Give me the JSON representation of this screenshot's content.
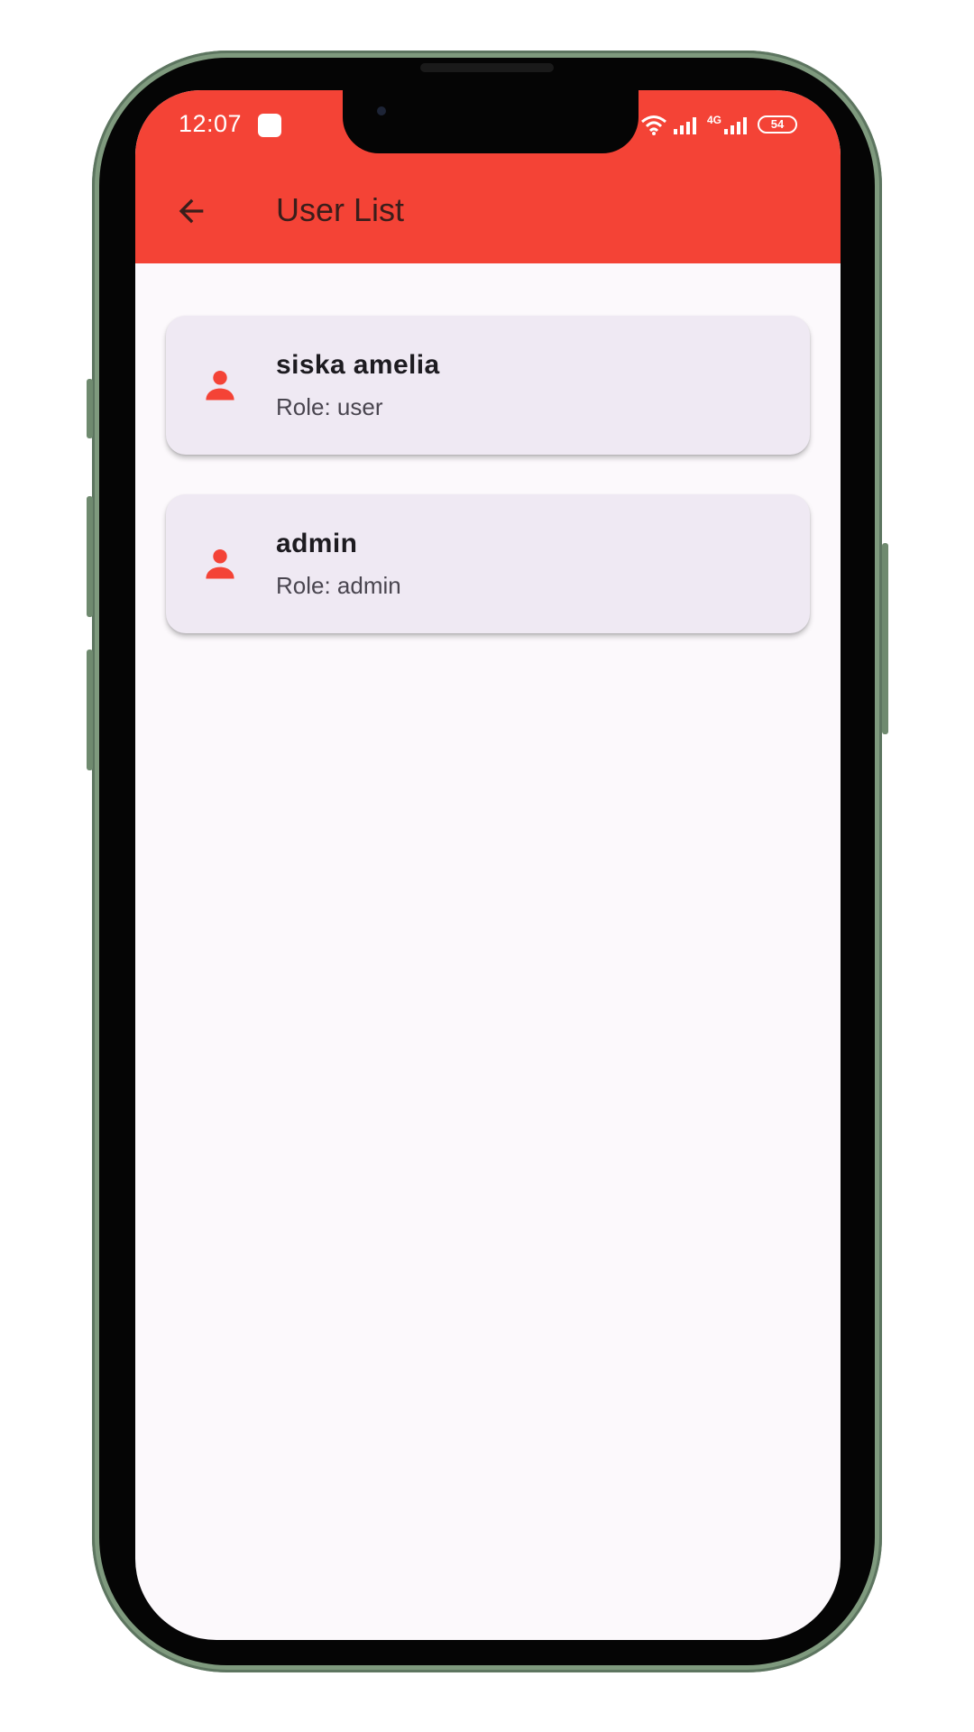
{
  "status_bar": {
    "time": "12:07",
    "battery_level": "54",
    "network_label": "4G"
  },
  "app_bar": {
    "title": "User List",
    "color": "#f44336"
  },
  "users": [
    {
      "name": "siska amelia",
      "role": "Role: user"
    },
    {
      "name": "admin",
      "role": "Role: admin"
    }
  ],
  "icons": {
    "back": "arrow-left-icon",
    "user": "person-icon"
  }
}
